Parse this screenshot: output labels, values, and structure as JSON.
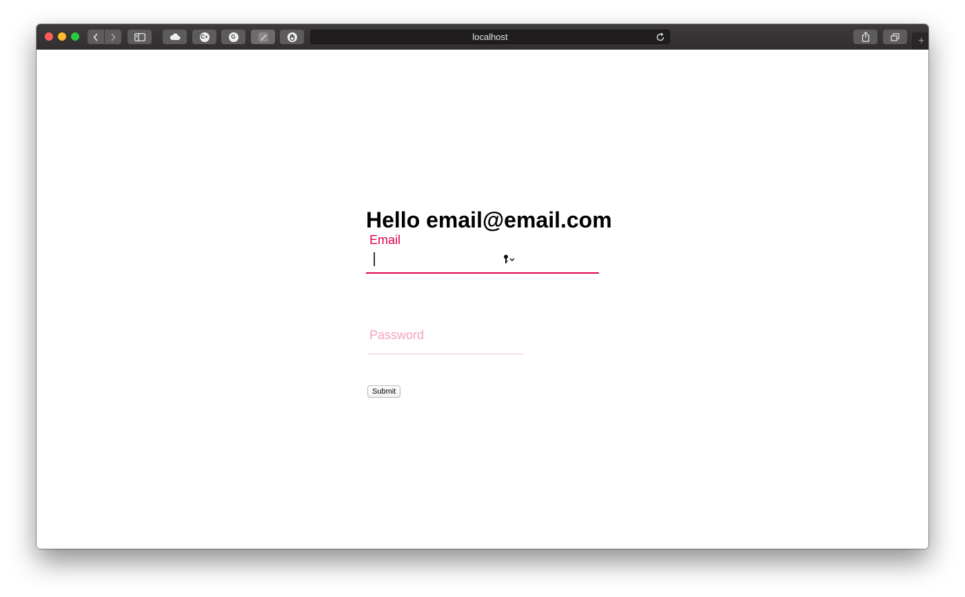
{
  "browser": {
    "address": "localhost",
    "traffic_light_colors": {
      "close": "#ff5f57",
      "minimize": "#febc2e",
      "zoom": "#28c840"
    },
    "toolbar_icons": [
      "back-icon",
      "forward-icon",
      "sidebar-icon",
      "cloud-icon",
      "c-plus-extension-icon",
      "grammarly-icon",
      "pen-extension-icon",
      "hand-extension-icon",
      "reload-icon",
      "share-icon",
      "tabs-icon",
      "plus-icon"
    ],
    "new_tab_label": "+"
  },
  "page": {
    "heading": "Hello email@email.com",
    "email": {
      "label": "Email",
      "value": ""
    },
    "password": {
      "label": "Password",
      "value": ""
    },
    "submit_label": "Submit",
    "accent_color": "#e0004d",
    "muted_accent_color": "#f4a2bd"
  }
}
